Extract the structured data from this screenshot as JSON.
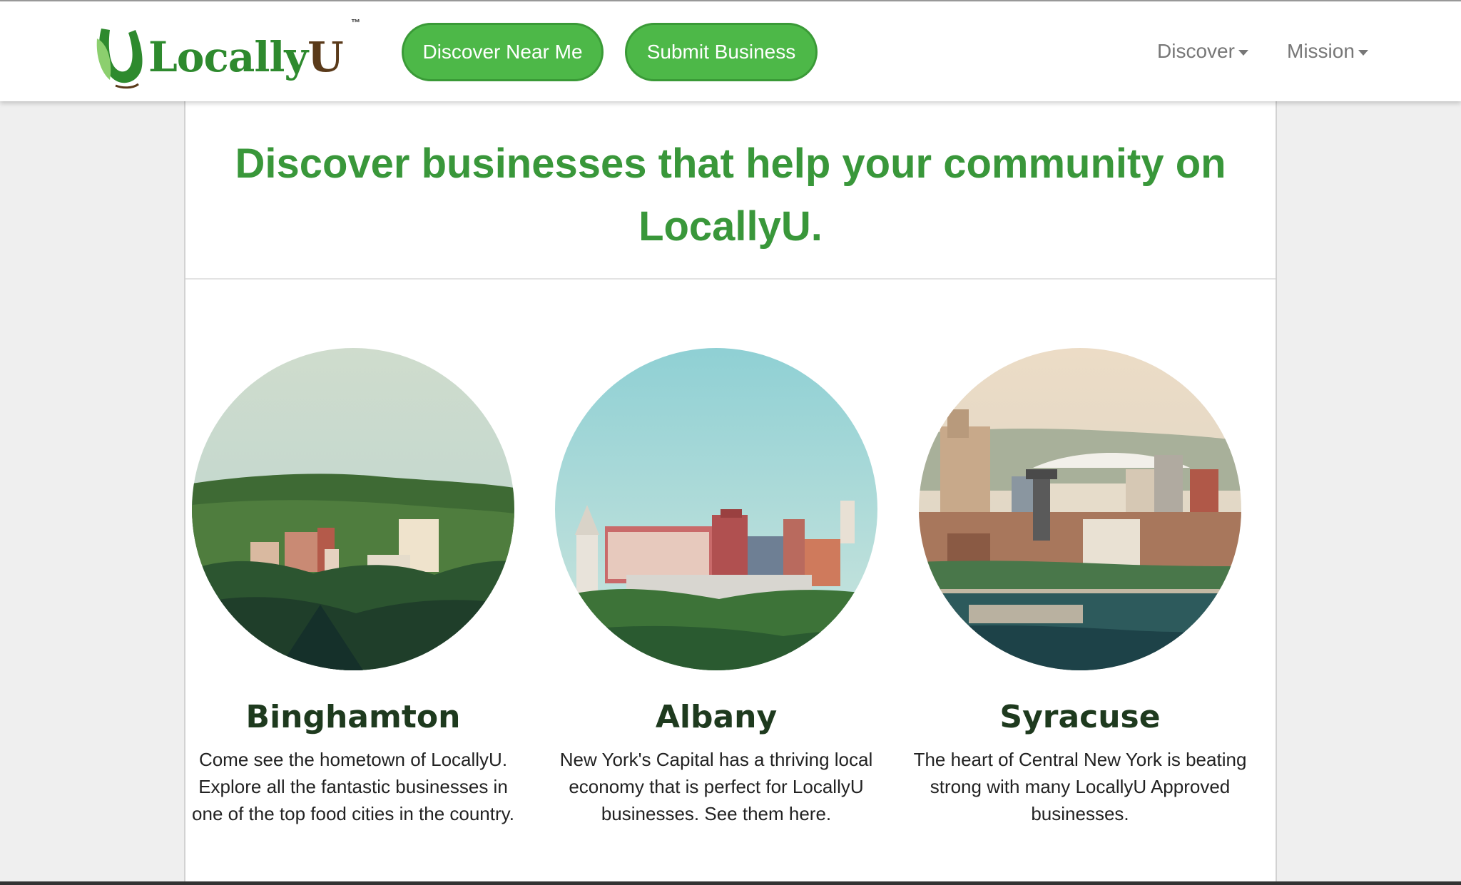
{
  "brand": {
    "name_part1": "Locally",
    "name_part2": "U",
    "trademark": "™",
    "colors": {
      "green": "#4db848",
      "dark_green": "#39973a",
      "brown": "#5a3a1a"
    }
  },
  "header": {
    "discover_near_me": "Discover Near Me",
    "submit_business": "Submit Business",
    "nav": [
      {
        "label": "Discover",
        "icon": "caret-down-icon"
      },
      {
        "label": "Mission",
        "icon": "caret-down-icon"
      }
    ]
  },
  "main": {
    "headline": "Discover businesses that help your community on LocallyU.",
    "cities": [
      {
        "name": "Binghamton",
        "description": "Come see the hometown of LocallyU. Explore all the fantastic businesses in one of the top food cities in the country."
      },
      {
        "name": "Albany",
        "description": "New York's Capital has a thriving local economy that is perfect for LocallyU businesses. See them here."
      },
      {
        "name": "Syracuse",
        "description": "The heart of Central New York is beating strong with many LocallyU Approved businesses."
      }
    ]
  }
}
